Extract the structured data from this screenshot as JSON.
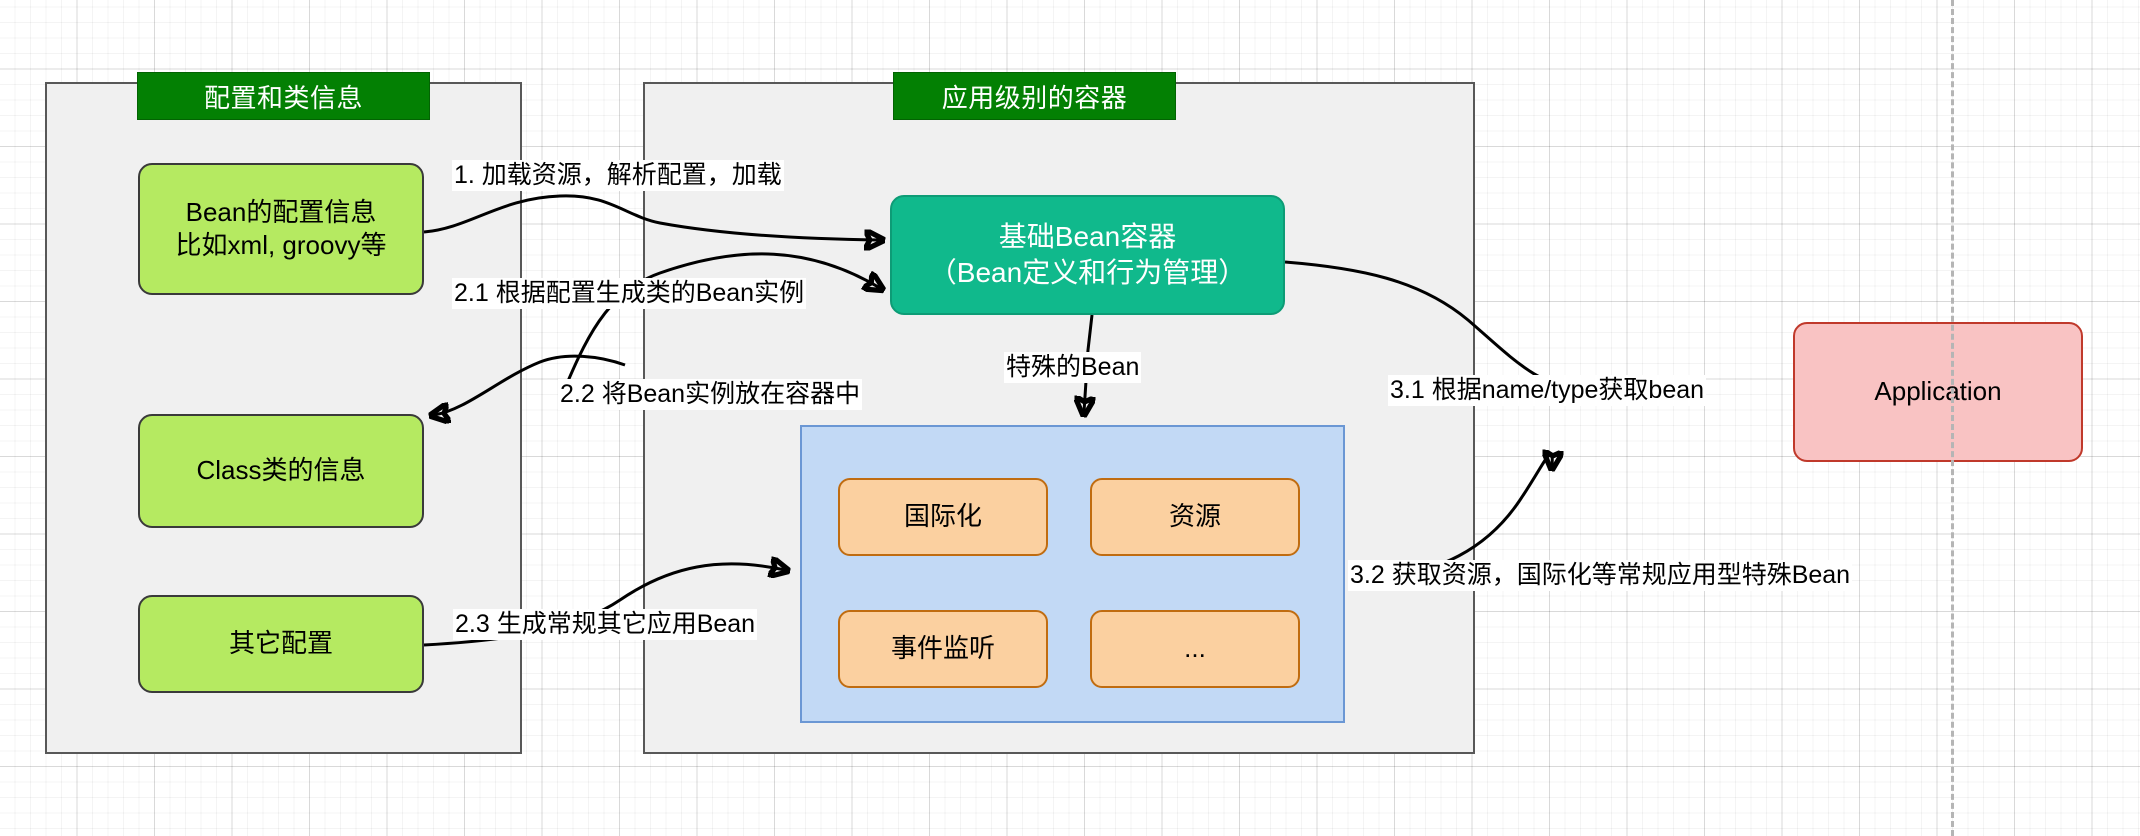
{
  "diagram": {
    "title": "Spring Bean Container Architecture Flow",
    "groups": [
      {
        "id": "left",
        "title": "配置和类信息"
      },
      {
        "id": "right",
        "title": "应用级别的容器"
      }
    ],
    "nodes": {
      "bean_config": "Bean的配置信息\n比如xml, groovy等",
      "class_info": "Class类的信息",
      "other_config": "其它配置",
      "bean_container": "基础Bean容器\n（Bean定义和行为管理）",
      "i18n": "国际化",
      "resource": "资源",
      "event_listener": "事件监听",
      "ellipsis": "...",
      "application": "Application"
    },
    "edge_labels": {
      "e1": "1. 加载资源，解析配置，加载",
      "e21": "2.1  根据配置生成类的Bean实例",
      "e22": "2.2 将Bean实例放在容器中",
      "e23": "2.3 生成常规其它应用Bean",
      "special_bean": "特殊的Bean",
      "e31": "3.1 根据name/type获取bean",
      "e32": "3.2  获取资源，国际化等常规应用型特殊Bean"
    },
    "colors": {
      "group_title_bg": "#038003",
      "group_bg": "#f0f0f0",
      "green_node": "#b5ea61",
      "teal_node": "#10b98c",
      "orange_node": "#fbd0a0",
      "orange_border": "#c06c10",
      "blue_subgroup": "#c2d9f5",
      "blue_border": "#6b97d4",
      "pink_node": "#f9c3c3",
      "pink_border": "#c0392b",
      "edge_stroke": "#000000"
    }
  }
}
